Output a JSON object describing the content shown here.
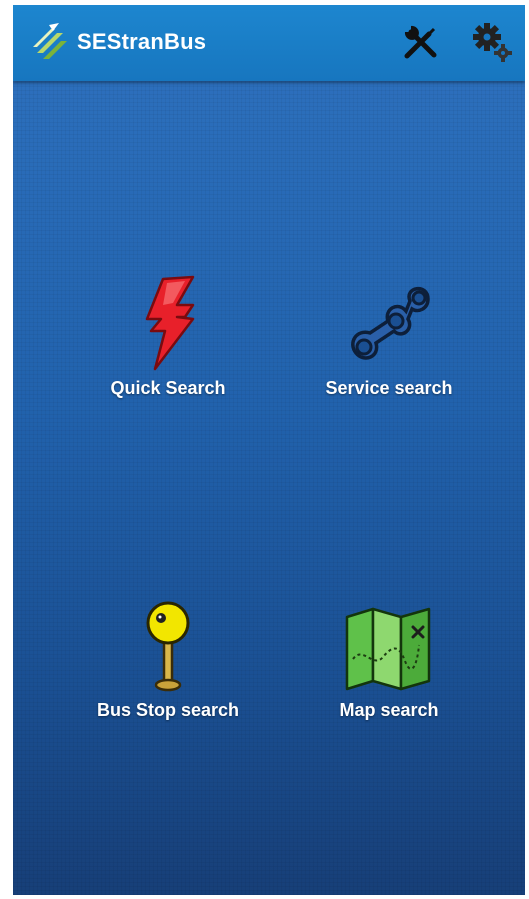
{
  "app": {
    "title": "SEStranBus"
  },
  "actions": {
    "tools_icon": "tools-icon",
    "settings_icon": "settings-gear-icon"
  },
  "tiles": [
    {
      "label": "Quick Search",
      "icon": "lightning-bolt-icon"
    },
    {
      "label": "Service search",
      "icon": "chain-links-icon"
    },
    {
      "label": "Bus Stop search",
      "icon": "map-pin-icon"
    },
    {
      "label": "Map search",
      "icon": "folded-map-icon"
    }
  ],
  "colors": {
    "app_bar": "#1776bf",
    "background_top": "#2c6fbc",
    "background_bottom": "#173f78",
    "bolt": "#e8202a",
    "pin": "#f2e600",
    "map": "#5fc14a"
  }
}
